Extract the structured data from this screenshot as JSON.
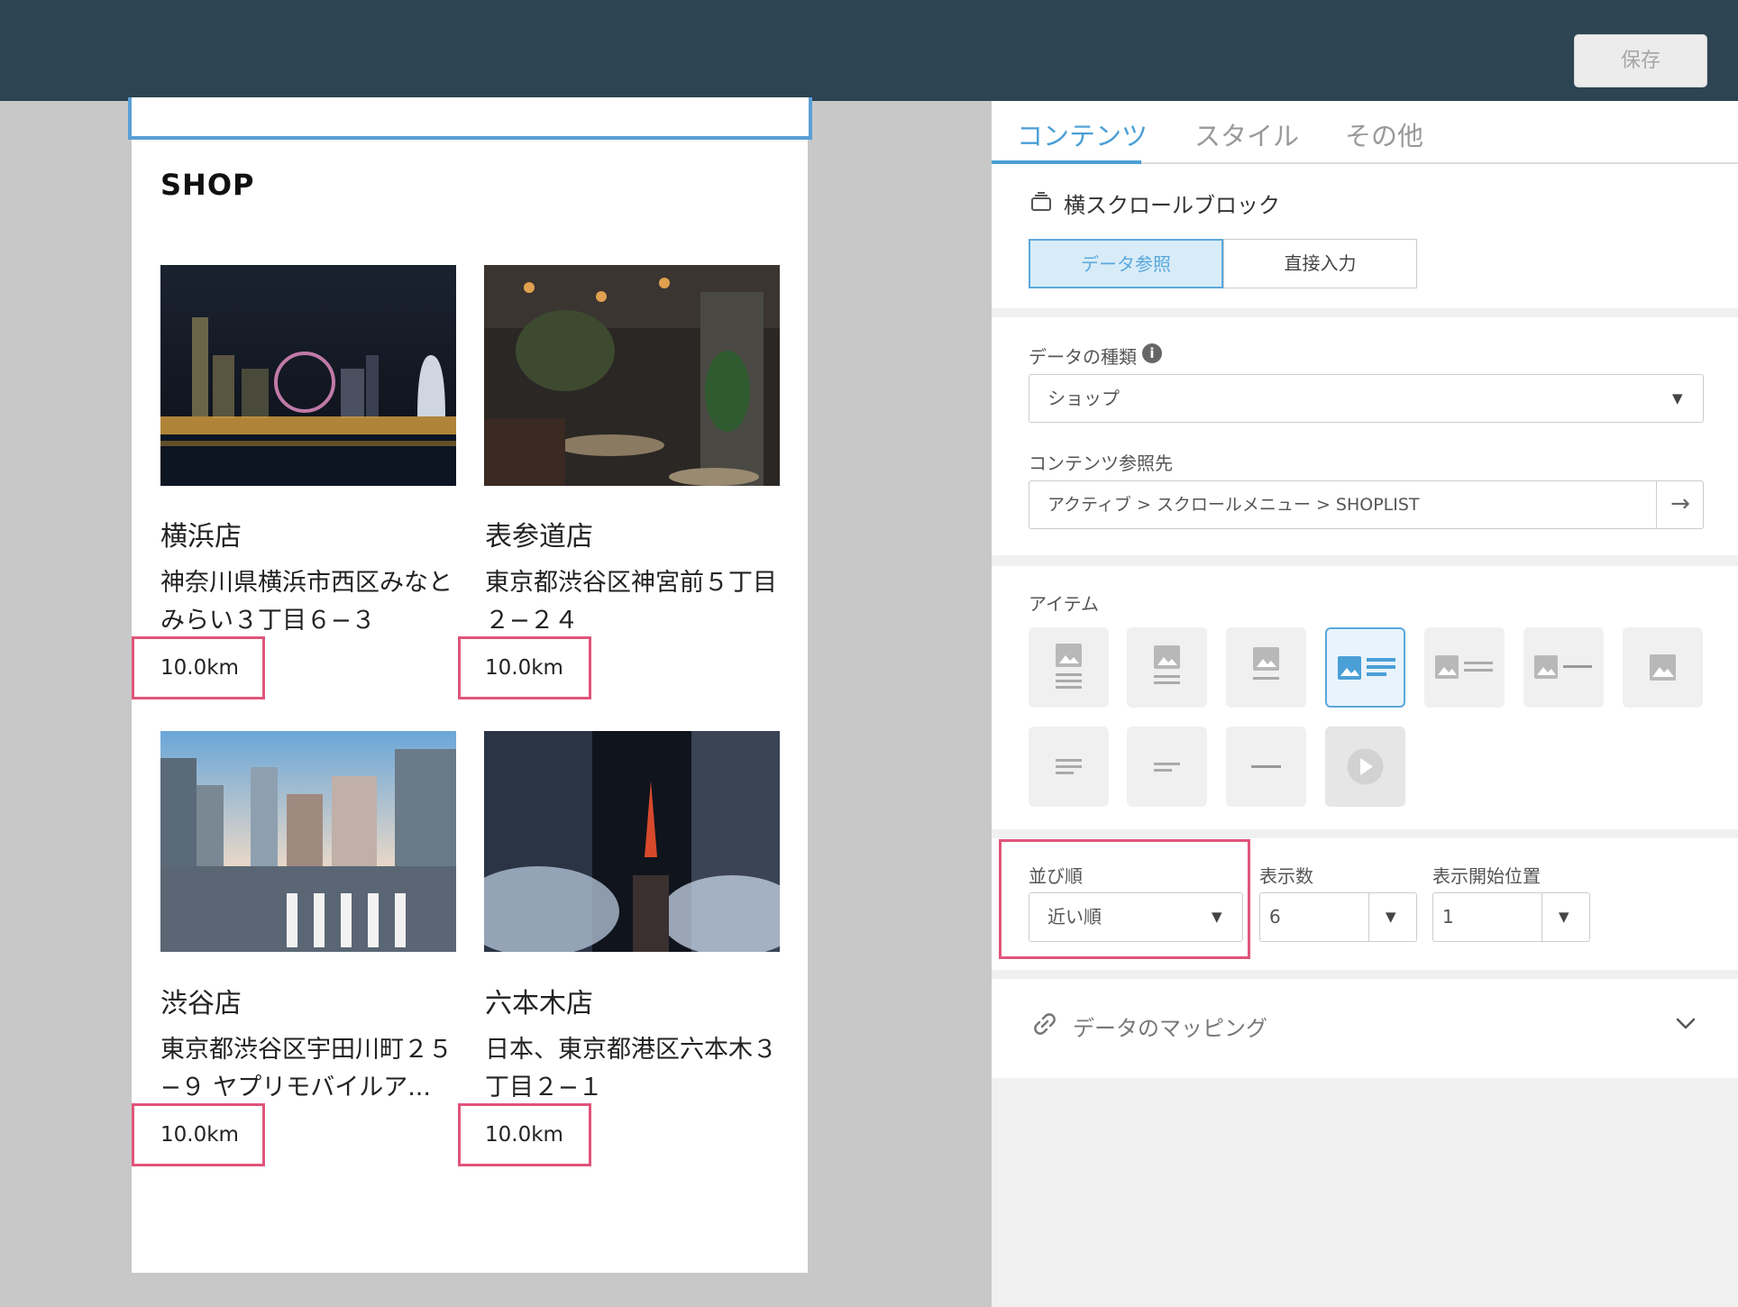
{
  "toolbar": {
    "save_label": "保存"
  },
  "preview": {
    "section_title": "SHOP",
    "cards": [
      {
        "name": "横浜店",
        "address": "神奈川県横浜市西区みなとみらい３丁目６−３",
        "distance": "10.0km"
      },
      {
        "name": "表参道店",
        "address": "東京都渋谷区神宮前５丁目２−２４",
        "distance": "10.0km"
      },
      {
        "name": "渋谷店",
        "address": "東京都渋谷区宇田川町２５−９ ヤプリモバイルア...",
        "distance": "10.0km"
      },
      {
        "name": "六本木店",
        "address": "日本、東京都港区六本木３丁目２−１",
        "distance": "10.0km"
      }
    ]
  },
  "panel": {
    "tabs": [
      {
        "label": "コンテンツ",
        "active": true
      },
      {
        "label": "スタイル",
        "active": false
      },
      {
        "label": "その他",
        "active": false
      }
    ],
    "block_title": "横スクロールブロック",
    "source_modes": [
      "データ参照",
      "直接入力"
    ],
    "data_type_label": "データの種類",
    "data_type_value": "ショップ",
    "content_ref_label": "コンテンツ参照先",
    "content_ref_value": "アクティブ > スクロールメニュー > SHOPLIST",
    "items_label": "アイテム",
    "item_layouts": [
      "image-top-three-lines-icon",
      "image-top-two-lines-icon",
      "image-top-one-line-icon",
      "image-left-text-lines-icon",
      "image-left-two-lines-icon",
      "image-left-one-line-icon",
      "image-only-icon",
      "text-three-lines-icon",
      "text-two-lines-icon",
      "text-one-line-icon",
      "video-play-icon"
    ],
    "selected_item_index": 3,
    "order_label": "並び順",
    "order_value": "近い順",
    "count_label": "表示数",
    "count_value": "6",
    "start_label": "表示開始位置",
    "start_value": "1",
    "mapping_label": "データのマッピング"
  },
  "colors": {
    "topbar": "#2d4452",
    "accent": "#4a9fd6",
    "highlight": "#e0557a"
  }
}
